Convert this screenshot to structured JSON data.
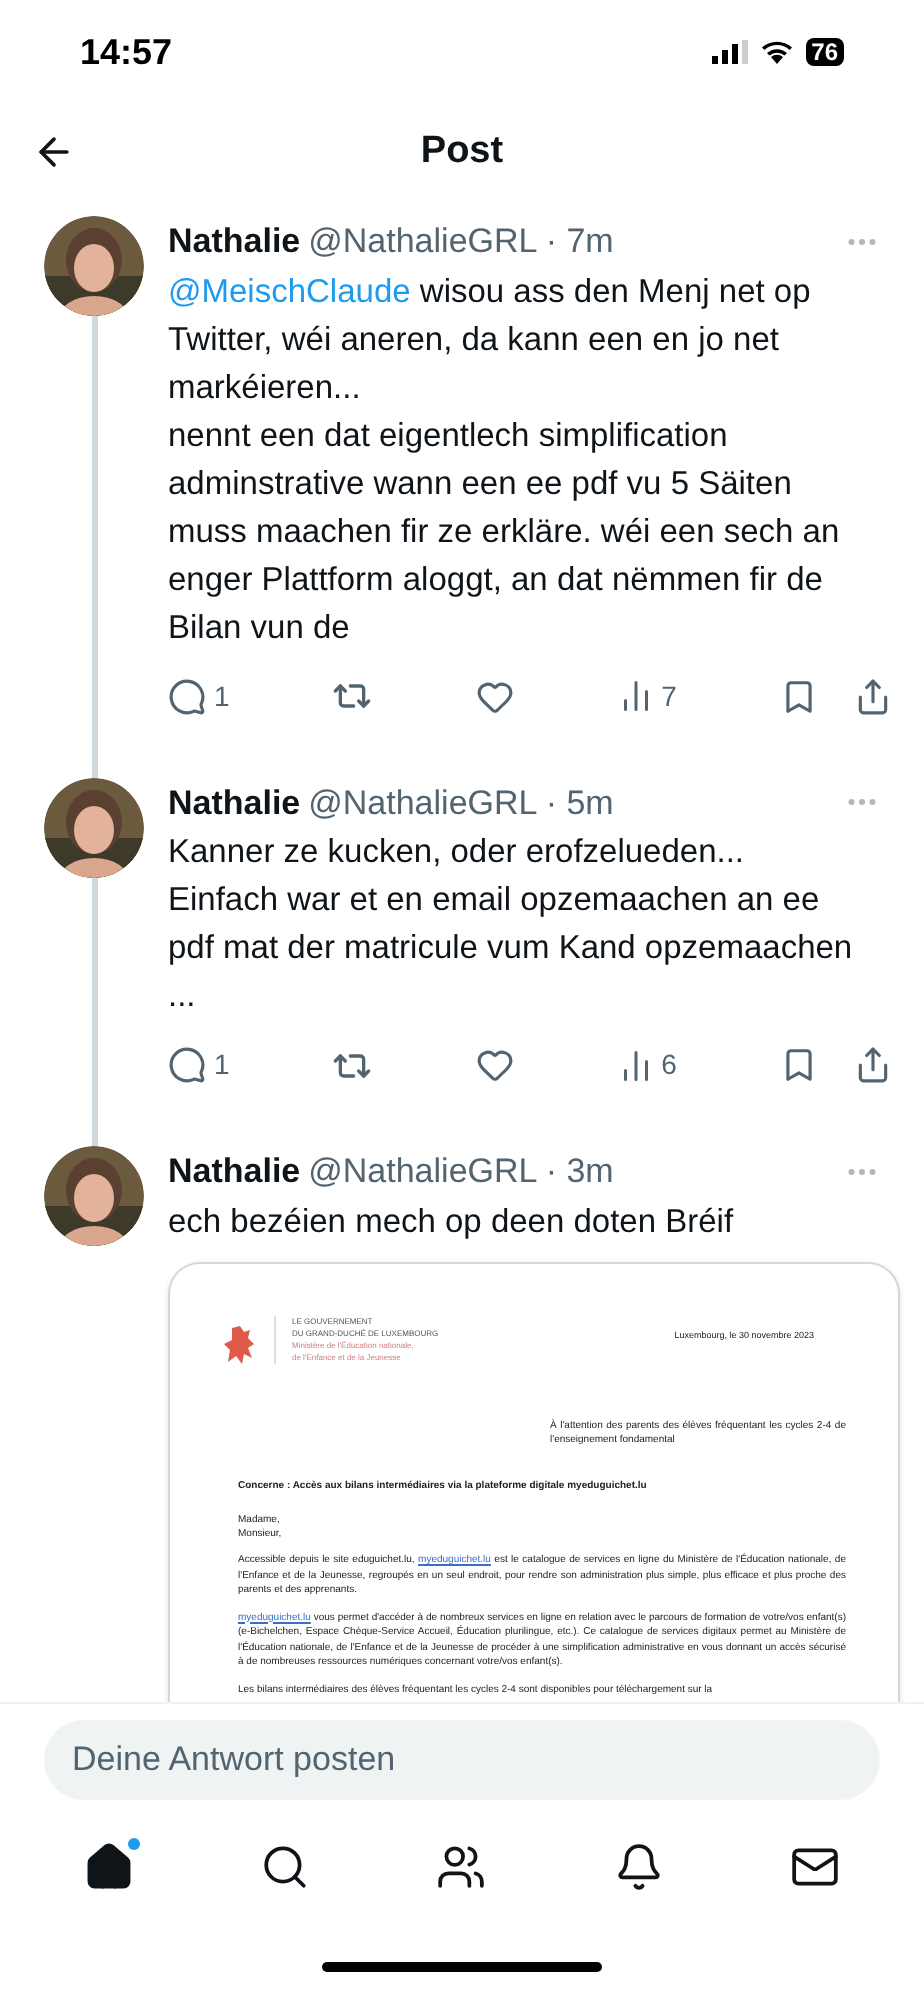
{
  "status_bar": {
    "time": "14:57",
    "battery": "76"
  },
  "header": {
    "title": "Post"
  },
  "posts": [
    {
      "name": "Nathalie",
      "handle": "@NathalieGRL",
      "separator": "·",
      "time": "7m",
      "paragraphs": [
        {
          "mention": "@MeischClaude",
          "text": " wisou ass den Menj net op Twitter, wéi aneren, da kann een en jo net markéieren..."
        },
        {
          "text": "nennt een dat eigentlech simplification adminstrative wann een ee pdf vu 5 Säiten muss maachen fir ze erkläre. wéi een sech an enger Plattform aloggt, an dat nëmmen fir de Bilan vun de"
        }
      ],
      "replies": "1",
      "views": "7"
    },
    {
      "name": "Nathalie",
      "handle": "@NathalieGRL",
      "separator": "·",
      "time": "5m",
      "paragraphs": [
        {
          "text": "Kanner ze kucken, oder erofzelueden... Einfach war et en email opzemaachen an ee pdf mat der matricule vum Kand opzemaachen ..."
        }
      ],
      "replies": "1",
      "views": "6"
    },
    {
      "name": "Nathalie",
      "handle": "@NathalieGRL",
      "separator": "·",
      "time": "3m",
      "paragraphs": [
        {
          "text": "ech bezéien mech op deen doten Bréif"
        }
      ],
      "document": {
        "org": [
          "LE GOUVERNEMENT",
          "DU GRAND-DUCHÉ DE LUXEMBOURG"
        ],
        "ministry": [
          "Ministère de l'Éducation nationale,",
          "de l'Enfance et de la Jeunesse"
        ],
        "date": "Luxembourg, le 30 novembre 2023",
        "recipient": "À l'attention des parents des élèves fréquentant les cycles 2-4 de l'enseignement fondamental",
        "subject": "Concerne : Accès aux bilans intermédiaires via la plateforme digitale myeduguichet.lu",
        "salutation": [
          "Madame,",
          "Monsieur,"
        ],
        "body": [
          {
            "before": "Accessible depuis le site eduguichet.lu, ",
            "linktext": "myeduguichet.lu",
            "after": " est le catalogue de services en ligne du Ministère de l'Éducation nationale, de l'Enfance et de la Jeunesse, regroupés en un seul endroit, pour rendre son administration plus simple, plus efficace et plus proche des parents et des apprenants."
          },
          {
            "linktext": "myeduguichet.lu",
            "after": " vous permet d'accéder à de nombreux services en ligne en relation avec le parcours de formation de votre/vos enfant(s) (e-Bichelchen, Espace Chèque-Service Accueil, Éducation plurilingue, etc.). Ce catalogue de services digitaux permet au Ministère de l'Éducation nationale, de l'Enfance et de la Jeunesse de procéder à une simplification administrative en vous donnant un accès sécurisé à de nombreuses ressources numériques concernant votre/vos enfant(s)."
          },
          {
            "before": "Les bilans intermédiaires des élèves fréquentant les cycles 2-4 sont disponibles pour téléchargement sur la"
          }
        ]
      }
    }
  ],
  "reply": {
    "placeholder": "Deine Antwort posten"
  },
  "nav": [
    {
      "kind": "home",
      "selected": true
    },
    {
      "kind": "search",
      "selected": false
    },
    {
      "kind": "people",
      "selected": false
    },
    {
      "kind": "notifications",
      "selected": false
    },
    {
      "kind": "messages",
      "selected": false
    }
  ]
}
